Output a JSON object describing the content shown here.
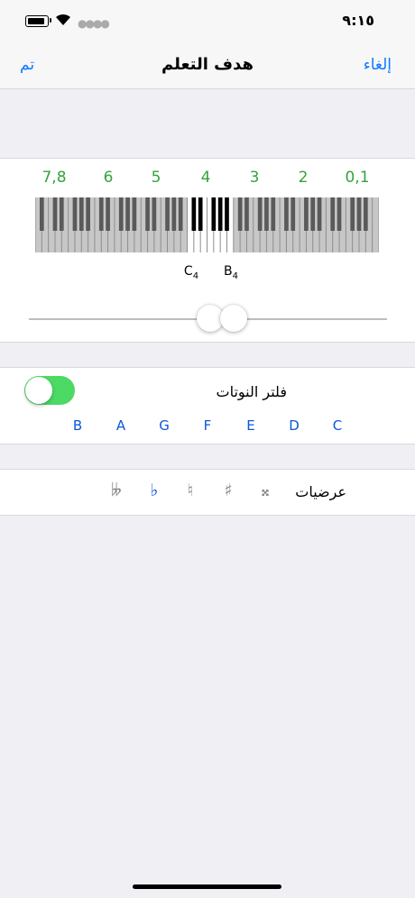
{
  "status_bar": {
    "time": "٩:١٥"
  },
  "nav": {
    "left_label": "تم",
    "title": "هدف التعلم",
    "right_label": "إلغاء"
  },
  "range": {
    "octave_labels": [
      "7,8",
      "6",
      "5",
      "4",
      "3",
      "2",
      "0,1"
    ],
    "low_note": {
      "letter": "C",
      "octave": "4"
    },
    "high_note": {
      "letter": "B",
      "octave": "4"
    },
    "selected_octave": 4,
    "slider_low": 0.507,
    "slider_high": 0.571,
    "accent_color": "#0a7aff"
  },
  "note_filter": {
    "label": "فلتر النوتات",
    "enabled": true,
    "notes": [
      "B",
      "A",
      "G",
      "F",
      "E",
      "D",
      "C"
    ]
  },
  "accidentals": {
    "label": "عرضيات",
    "symbols": [
      {
        "glyph": "𝄫",
        "name": "double-flat",
        "active": false
      },
      {
        "glyph": "♭",
        "name": "flat",
        "active": true
      },
      {
        "glyph": "♮",
        "name": "natural",
        "active": false
      },
      {
        "glyph": "♯",
        "name": "sharp",
        "active": false
      },
      {
        "glyph": "𝄪",
        "name": "double-sharp",
        "active": false
      }
    ]
  },
  "colors": {
    "toggle_on": "#4cd964",
    "octave_labels": "#34a33d",
    "note_letters": "#0a58d6"
  }
}
